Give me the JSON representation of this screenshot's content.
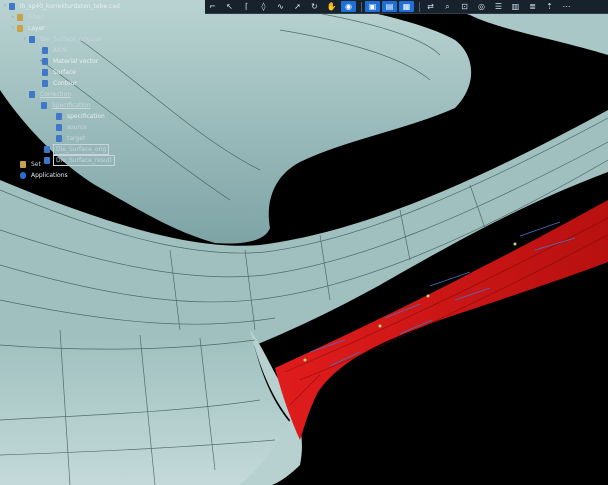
{
  "tree": {
    "root": "lh_sp40_korrekturdaten_tebe.cad",
    "items": [
      {
        "label": "Filter"
      },
      {
        "label": "Layer"
      },
      {
        "label": "Die_Surface_original"
      },
      {
        "label": "AXIS"
      },
      {
        "label": "Material vector"
      },
      {
        "label": "Surface"
      },
      {
        "label": "Contour"
      },
      {
        "label": "Correction"
      },
      {
        "label": "Specification"
      },
      {
        "label": "specification"
      },
      {
        "label": "source"
      },
      {
        "label": "target"
      },
      {
        "label": "Die_Surface_orig"
      },
      {
        "label": "Die_Surface_result"
      },
      {
        "label": "Set"
      },
      {
        "label": "Applications"
      }
    ]
  },
  "toolbar": {
    "icons": [
      "polyline-icon",
      "select-icon",
      "bracket-icon",
      "node-icon",
      "curve-icon",
      "arrow-icon",
      "rotate-icon",
      "hand-icon",
      "render-icon",
      "view-front-icon",
      "view-side-icon",
      "view-top-icon",
      "sync-icon",
      "zoom-icon",
      "fit-icon",
      "target-icon",
      "layers-icon",
      "table-icon",
      "list-icon",
      "up-icon",
      "more-icon"
    ]
  },
  "colors": {
    "background": "#000000",
    "surface": "#93b7b6",
    "highlight": "#c81616",
    "annotation": "#4d6ec0"
  }
}
